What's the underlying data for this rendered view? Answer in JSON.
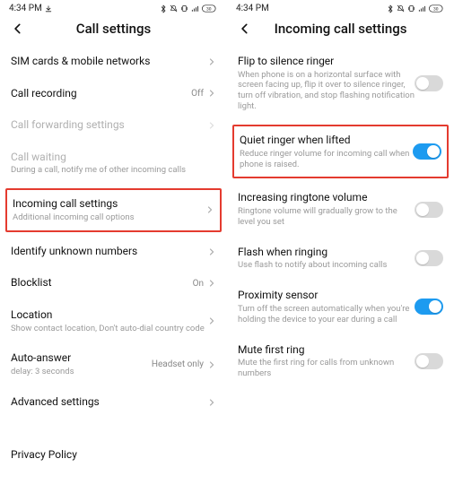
{
  "statusbar": {
    "time": "4:34 PM",
    "battery": "30"
  },
  "colors": {
    "accent": "#1d9bf0",
    "highlight": "#e43b2f"
  },
  "left_screen": {
    "title": "Call settings",
    "items": {
      "sim": {
        "label": "SIM cards & mobile networks"
      },
      "recording": {
        "label": "Call recording",
        "value": "Off"
      },
      "forwarding": {
        "label": "Call forwarding settings"
      },
      "waiting": {
        "label": "Call waiting",
        "desc": "During a call, notify me of other incoming calls"
      },
      "incoming": {
        "label": "Incoming call settings",
        "desc": "Additional incoming call options"
      },
      "identify": {
        "label": "Identify unknown numbers"
      },
      "blocklist": {
        "label": "Blocklist",
        "value": "On"
      },
      "location": {
        "label": "Location",
        "desc": "Show contact location, Don't auto-dial country code"
      },
      "autoanswer": {
        "label": "Auto-answer",
        "desc": "delay: 3 seconds",
        "value": "Headset only"
      },
      "advanced": {
        "label": "Advanced settings"
      },
      "privacy": {
        "label": "Privacy Policy"
      }
    }
  },
  "right_screen": {
    "title": "Incoming call settings",
    "items": {
      "flip": {
        "label": "Flip to silence ringer",
        "desc": "When phone is on a horizontal surface with screen facing up, flip it over to silence ringer, turn off vibration, and stop flashing notification light."
      },
      "quiet": {
        "label": "Quiet ringer when lifted",
        "desc": "Reduce ringer volume for incoming call when phone is raised."
      },
      "increasing": {
        "label": "Increasing ringtone volume",
        "desc": "Ringtone volume will gradually grow to the level you set"
      },
      "flash": {
        "label": "Flash when ringing",
        "desc": "Use flash to notify about incoming calls"
      },
      "proximity": {
        "label": "Proximity sensor",
        "desc": "Turn off the screen automatically when you're holding the device to your ear during a call"
      },
      "mute": {
        "label": "Mute first ring",
        "desc": "Mute the first ring for calls from unknown numbers"
      }
    }
  }
}
